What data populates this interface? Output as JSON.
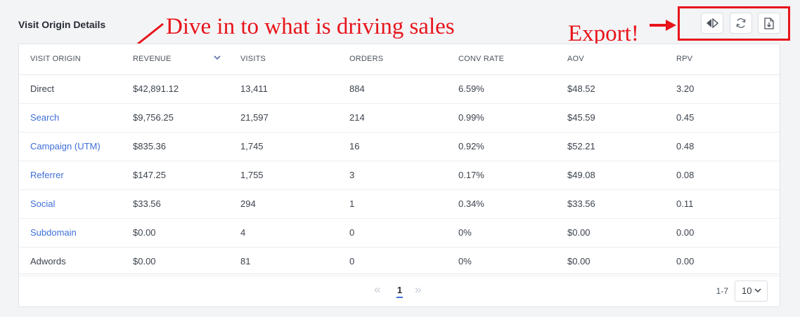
{
  "header": {
    "title": "Visit Origin Details"
  },
  "annotations": {
    "main": "Dive in to what is driving sales",
    "export": "Export!"
  },
  "toolbar": {
    "compare_icon": "compare-icon",
    "refresh_icon": "refresh-icon",
    "export_icon": "download-icon"
  },
  "table": {
    "columns": [
      "VISIT ORIGIN",
      "REVENUE",
      "VISITS",
      "ORDERS",
      "CONV RATE",
      "AOV",
      "RPV"
    ],
    "rows": [
      [
        "Direct",
        "$42,891.12",
        "13,411",
        "884",
        "6.59%",
        "$48.52",
        "3.20"
      ],
      [
        "Search",
        "$9,756.25",
        "21,597",
        "214",
        "0.99%",
        "$45.59",
        "0.45"
      ],
      [
        "Campaign (UTM)",
        "$835.36",
        "1,745",
        "16",
        "0.92%",
        "$52.21",
        "0.48"
      ],
      [
        "Referrer",
        "$147.25",
        "1,755",
        "3",
        "0.17%",
        "$49.08",
        "0.08"
      ],
      [
        "Social",
        "$33.56",
        "294",
        "1",
        "0.34%",
        "$33.56",
        "0.11"
      ],
      [
        "Subdomain",
        "$0.00",
        "4",
        "0",
        "0%",
        "$0.00",
        "0.00"
      ],
      [
        "Adwords",
        "$0.00",
        "81",
        "0",
        "0%",
        "$0.00",
        "0.00"
      ]
    ]
  },
  "pagination": {
    "prev": "«",
    "current_page": "1",
    "next": "»",
    "range": "1-7",
    "per_page": "10"
  },
  "colors": {
    "accent": "#3f6fd9",
    "annotation": "#e8141b"
  }
}
